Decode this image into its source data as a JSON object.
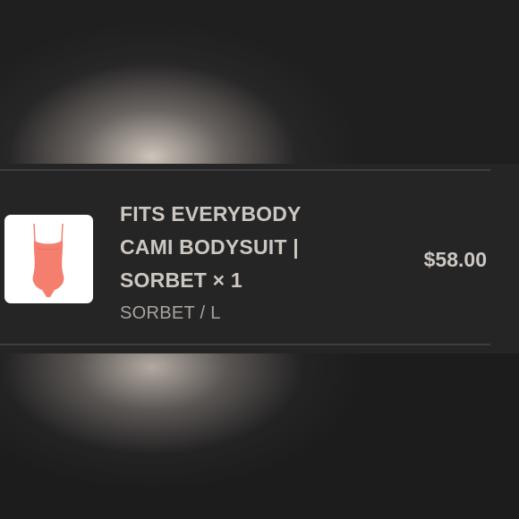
{
  "order_item": {
    "product_title": "FITS EVERYBODY CAMI BODYSUIT | SORBET × 1",
    "variant": "SORBET / L",
    "price": "$58.00",
    "thumbnail_icon": "bodysuit-product-image",
    "product_color": "#f47f6e"
  }
}
